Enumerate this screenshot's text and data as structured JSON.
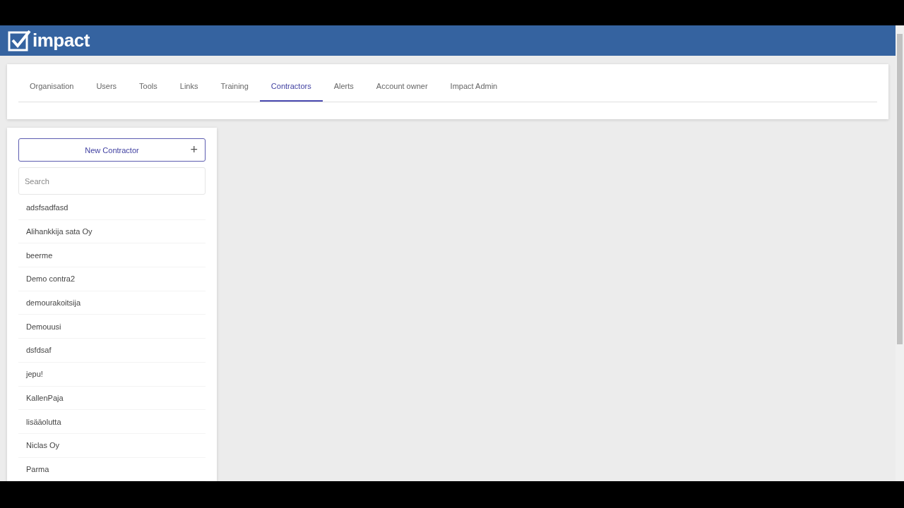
{
  "header": {
    "logo_text": "impact"
  },
  "tabs": [
    {
      "label": "Organisation",
      "selected": false
    },
    {
      "label": "Users",
      "selected": false
    },
    {
      "label": "Tools",
      "selected": false
    },
    {
      "label": "Links",
      "selected": false
    },
    {
      "label": "Training",
      "selected": false
    },
    {
      "label": "Contractors",
      "selected": true
    },
    {
      "label": "Alerts",
      "selected": false
    },
    {
      "label": "Account owner",
      "selected": false
    },
    {
      "label": "Impact Admin",
      "selected": false
    }
  ],
  "sidebar": {
    "new_button": {
      "label": "New Contractor",
      "icon": "+"
    },
    "search": {
      "placeholder": "Search"
    },
    "items": [
      "adsfsadfasd",
      "Alihankkija sata Oy",
      "beerme",
      "Demo contra2",
      "demourakoitsija",
      "Demouusi",
      "dsfdsaf",
      "jepu!",
      "KallenPaja",
      "lisääolutta",
      "Niclas Oy",
      "Parma"
    ]
  }
}
